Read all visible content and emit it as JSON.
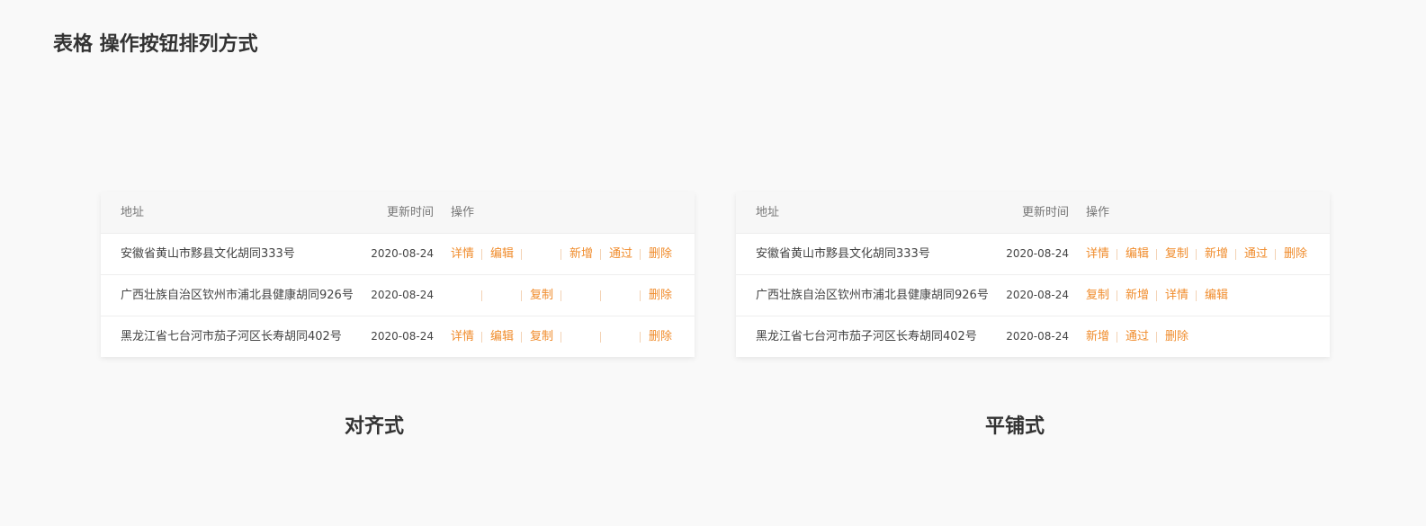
{
  "page": {
    "title": "表格 操作按钮排列方式"
  },
  "columns": {
    "address": "地址",
    "updated": "更新时间",
    "actions": "操作"
  },
  "colors": {
    "accent": "#f08c2c",
    "separator": "#f3d2b4",
    "background": "#f9f9f9"
  },
  "aligned": {
    "caption": "对齐式",
    "rows": [
      {
        "address": "安徽省黄山市黟县文化胡同333号",
        "date": "2020-08-24",
        "slots": [
          "详情",
          "编辑",
          "",
          "新增",
          "通过",
          "删除"
        ]
      },
      {
        "address": "广西壮族自治区钦州市浦北县健康胡同926号",
        "date": "2020-08-24",
        "slots": [
          "",
          "",
          "复制",
          "",
          "",
          "删除"
        ]
      },
      {
        "address": "黑龙江省七台河市茄子河区长寿胡同402号",
        "date": "2020-08-24",
        "slots": [
          "详情",
          "编辑",
          "复制",
          "",
          "",
          "删除"
        ]
      }
    ]
  },
  "tiled": {
    "caption": "平铺式",
    "rows": [
      {
        "address": "安徽省黄山市黟县文化胡同333号",
        "date": "2020-08-24",
        "actions": [
          "详情",
          "编辑",
          "复制",
          "新增",
          "通过",
          "删除"
        ]
      },
      {
        "address": "广西壮族自治区钦州市浦北县健康胡同926号",
        "date": "2020-08-24",
        "actions": [
          "复制",
          "新增",
          "详情",
          "编辑"
        ]
      },
      {
        "address": "黑龙江省七台河市茄子河区长寿胡同402号",
        "date": "2020-08-24",
        "actions": [
          "新增",
          "通过",
          "删除"
        ]
      }
    ]
  }
}
